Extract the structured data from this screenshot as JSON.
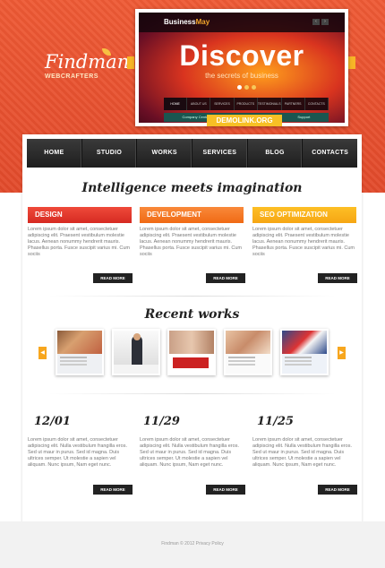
{
  "logo": {
    "name": "Findman",
    "tagline": "WEBCRAFTERS"
  },
  "slider": {
    "brand_prefix": "Business",
    "brand_suffix": "May",
    "headline": "Discover",
    "subline": "the secrets of business",
    "nav_items": [
      "HOME",
      "ABOUT US",
      "SERVICES",
      "PRODUCTS",
      "TESTIMONIALS",
      "PARTNERS",
      "CONTACTS"
    ],
    "strip_items": [
      "Company Center",
      "Solutions",
      "Support"
    ],
    "demo_link": "DEMOLINK.ORG"
  },
  "nav": [
    "HOME",
    "STUDIO",
    "WORKS",
    "SERVICES",
    "BLOG",
    "CONTACTS"
  ],
  "tagline": "Intelligence meets imagination",
  "columns": [
    {
      "title": "DESIGN",
      "text": "Lorem ipsum dolor sit amet, consectetuer adipiscing elit. Praesent vestibulum molestie lacus. Aenean nonummy hendrerit mauris. Phasellus porta. Fusce suscipit varius mi. Cum sociis",
      "button": "READ MORE",
      "color": "#e3392c"
    },
    {
      "title": "DEVELOPMENT",
      "text": "Lorem ipsum dolor sit amet, consectetuer adipiscing elit. Praesent vestibulum molestie lacus. Aenean nonummy hendrerit mauris. Phasellus porta. Fusce suscipit varius mi. Cum sociis",
      "button": "READ MORE",
      "color": "#f27a22"
    },
    {
      "title": "SEO OPTIMIZATION",
      "text": "Lorem ipsum dolor sit amet, consectetuer adipiscing elit. Praesent vestibulum molestie lacus. Aenean nonummy hendrerit mauris. Phasellus porta. Fusce suscipit varius mi. Cum sociis",
      "button": "READ MORE",
      "color": "#f9b21c"
    }
  ],
  "recent_works_title": "Recent works",
  "news": [
    {
      "date": "12/01",
      "text": "Lorem ipsum dolor sit amet, consectetuer adipiscing elit. Nulla vestibulum frangilla eros. Sed ut maur in purus. Sed id magna. Duis ultrices semper. Ut molestie a sapien vel aliquam. Nunc ipsum, Nam eget nunc.",
      "button": "READ MORE"
    },
    {
      "date": "11/29",
      "text": "Lorem ipsum dolor sit amet, consectetuer adipiscing elit. Nulla vestibulum frangilla eros. Sed ut maur in purus. Sed id magna. Duis ultrices semper. Ut molestie a sapien vel aliquam. Nunc ipsum, Nam eget nunc.",
      "button": "READ MORE"
    },
    {
      "date": "11/25",
      "text": "Lorem ipsum dolor sit amet, consectetuer adipiscing elit. Nulla vestibulum frangilla eros. Sed ut maur in purus. Sed id magna. Duis ultrices semper. Ut molestie a sapien vel aliquam. Nunc ipsum, Nam eget nunc.",
      "button": "READ MORE"
    }
  ],
  "footer": "Findman © 2012 Privacy Policy",
  "colors": {
    "header": "#e8502f",
    "accent": "#f7c025",
    "nav": "#222222"
  }
}
